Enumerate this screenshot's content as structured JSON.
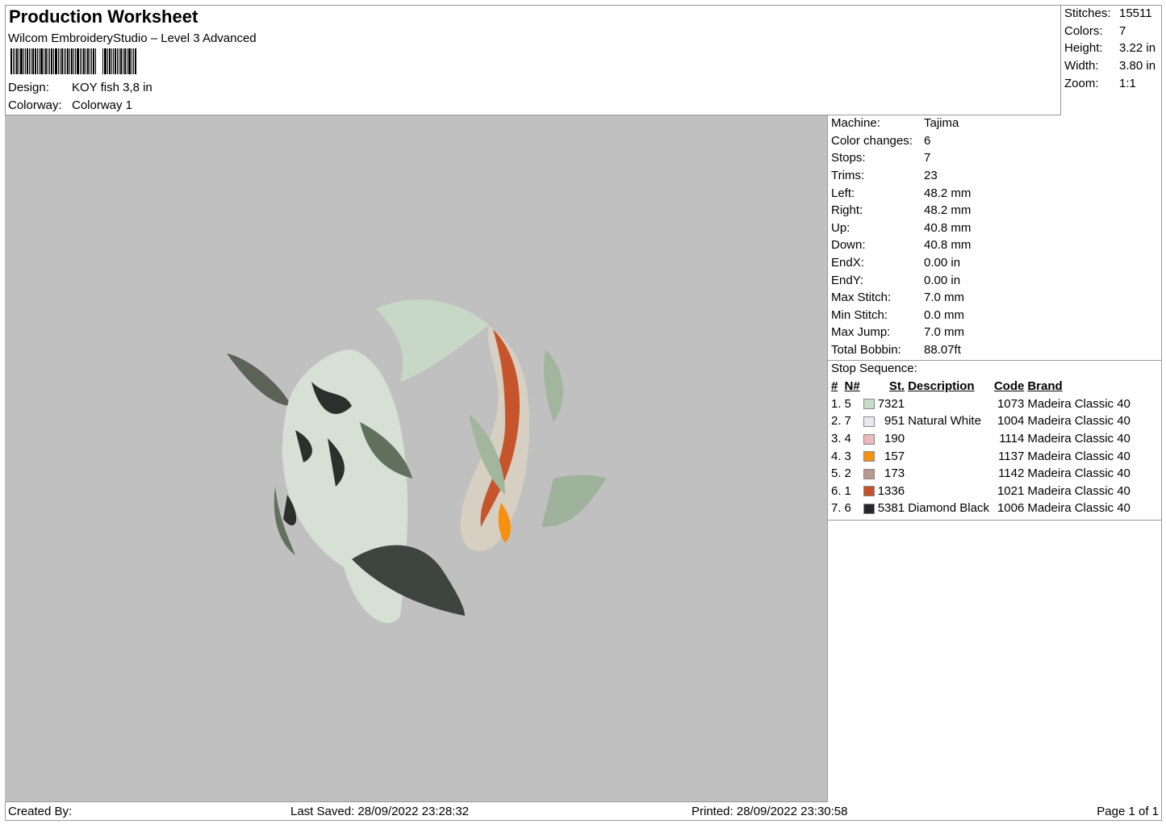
{
  "header": {
    "title": "Production Worksheet",
    "subtitle": "Wilcom EmbroideryStudio – Level 3 Advanced",
    "design_label": "Design:",
    "design": "KOY fish 3,8 in",
    "colorway_label": "Colorway:",
    "colorway": "Colorway 1"
  },
  "stats": [
    {
      "k": "Stitches:",
      "v": "15511"
    },
    {
      "k": "Colors:",
      "v": "7"
    },
    {
      "k": "Height:",
      "v": "3.22 in"
    },
    {
      "k": "Width:",
      "v": "3.80 in"
    },
    {
      "k": "Zoom:",
      "v": "1:1"
    }
  ],
  "info": [
    {
      "k": "Machine:",
      "v": "Tajima"
    },
    {
      "k": "Color changes:",
      "v": "6"
    },
    {
      "k": "Stops:",
      "v": "7"
    },
    {
      "k": "Trims:",
      "v": "23"
    },
    {
      "k": "Left:",
      "v": "48.2 mm"
    },
    {
      "k": "Right:",
      "v": "48.2 mm"
    },
    {
      "k": "Up:",
      "v": "40.8 mm"
    },
    {
      "k": "Down:",
      "v": "40.8 mm"
    },
    {
      "k": "EndX:",
      "v": "0.00 in"
    },
    {
      "k": "EndY:",
      "v": "0.00 in"
    },
    {
      "k": "Max Stitch:",
      "v": "7.0 mm"
    },
    {
      "k": "Min Stitch:",
      "v": "0.0 mm"
    },
    {
      "k": "Max Jump:",
      "v": "7.0 mm"
    },
    {
      "k": "Total Bobbin:",
      "v": "88.07ft"
    }
  ],
  "sequence": {
    "title": "Stop Sequence:",
    "headers": [
      "#",
      "N#",
      "St.",
      "Description",
      "Code",
      "Brand"
    ],
    "rows": [
      {
        "n": "1.",
        "nn": "5",
        "color": "#c8dcc8",
        "st": "7321",
        "desc": "",
        "code": "1073",
        "brand": "Madeira Classic 40"
      },
      {
        "n": "2.",
        "nn": "7",
        "color": "#e8e8f0",
        "st": "951",
        "desc": "Natural White",
        "code": "1004",
        "brand": "Madeira Classic 40"
      },
      {
        "n": "3.",
        "nn": "4",
        "color": "#ecb8b8",
        "st": "190",
        "desc": "",
        "code": "1114",
        "brand": "Madeira Classic 40"
      },
      {
        "n": "4.",
        "nn": "3",
        "color": "#f7900e",
        "st": "157",
        "desc": "",
        "code": "1137",
        "brand": "Madeira Classic 40"
      },
      {
        "n": "5.",
        "nn": "2",
        "color": "#b89a8c",
        "st": "173",
        "desc": "",
        "code": "1142",
        "brand": "Madeira Classic 40"
      },
      {
        "n": "6.",
        "nn": "1",
        "color": "#c4502c",
        "st": "1336",
        "desc": "",
        "code": "1021",
        "brand": "Madeira Classic 40"
      },
      {
        "n": "7.",
        "nn": "6",
        "color": "#262628",
        "st": "5381",
        "desc": "Diamond Black",
        "code": "1006",
        "brand": "Madeira Classic 40"
      }
    ]
  },
  "footer": {
    "created": "Created By:",
    "saved": "Last Saved: 28/09/2022 23:28:32",
    "printed": "Printed: 28/09/2022 23:30:58",
    "page": "Page 1 of 1"
  }
}
